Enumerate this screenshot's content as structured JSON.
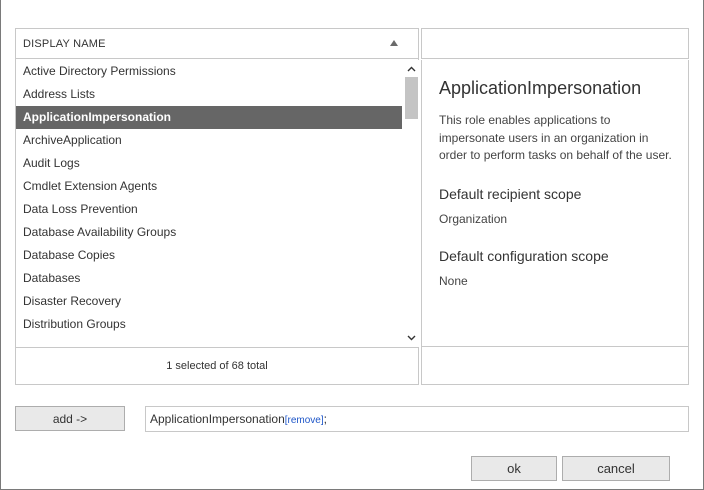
{
  "list": {
    "header": "DISPLAY NAME",
    "items": [
      {
        "label": "Active Directory Permissions"
      },
      {
        "label": "Address Lists"
      },
      {
        "label": "ApplicationImpersonation",
        "selected": true
      },
      {
        "label": "ArchiveApplication"
      },
      {
        "label": "Audit Logs"
      },
      {
        "label": "Cmdlet Extension Agents"
      },
      {
        "label": "Data Loss Prevention"
      },
      {
        "label": "Database Availability Groups"
      },
      {
        "label": "Database Copies"
      },
      {
        "label": "Databases"
      },
      {
        "label": "Disaster Recovery"
      },
      {
        "label": "Distribution Groups"
      }
    ],
    "status": "1 selected of 68 total"
  },
  "search": {
    "value": "",
    "placeholder": ""
  },
  "detail": {
    "title": "ApplicationImpersonation",
    "description": "This role enables applications to impersonate users in an organization in order to perform tasks on behalf of the user.",
    "recipient_scope_heading": "Default recipient scope",
    "recipient_scope_value": "Organization",
    "config_scope_heading": "Default configuration scope",
    "config_scope_value": "None"
  },
  "add": {
    "button_label": "add ->",
    "selected_value": "ApplicationImpersonation",
    "remove_label": "[remove]",
    "separator": ";"
  },
  "buttons": {
    "ok": "ok",
    "cancel": "cancel"
  },
  "icons": {
    "sort": "sort-ascending-icon",
    "scroll_up": "chevron-up-icon",
    "scroll_down": "chevron-down-icon"
  },
  "colors": {
    "selected_row_bg": "#666666",
    "selected_row_text": "#ffffff",
    "link": "#1e56c8",
    "border": "#c8c8c8",
    "button_bg": "#e9e9e9"
  }
}
